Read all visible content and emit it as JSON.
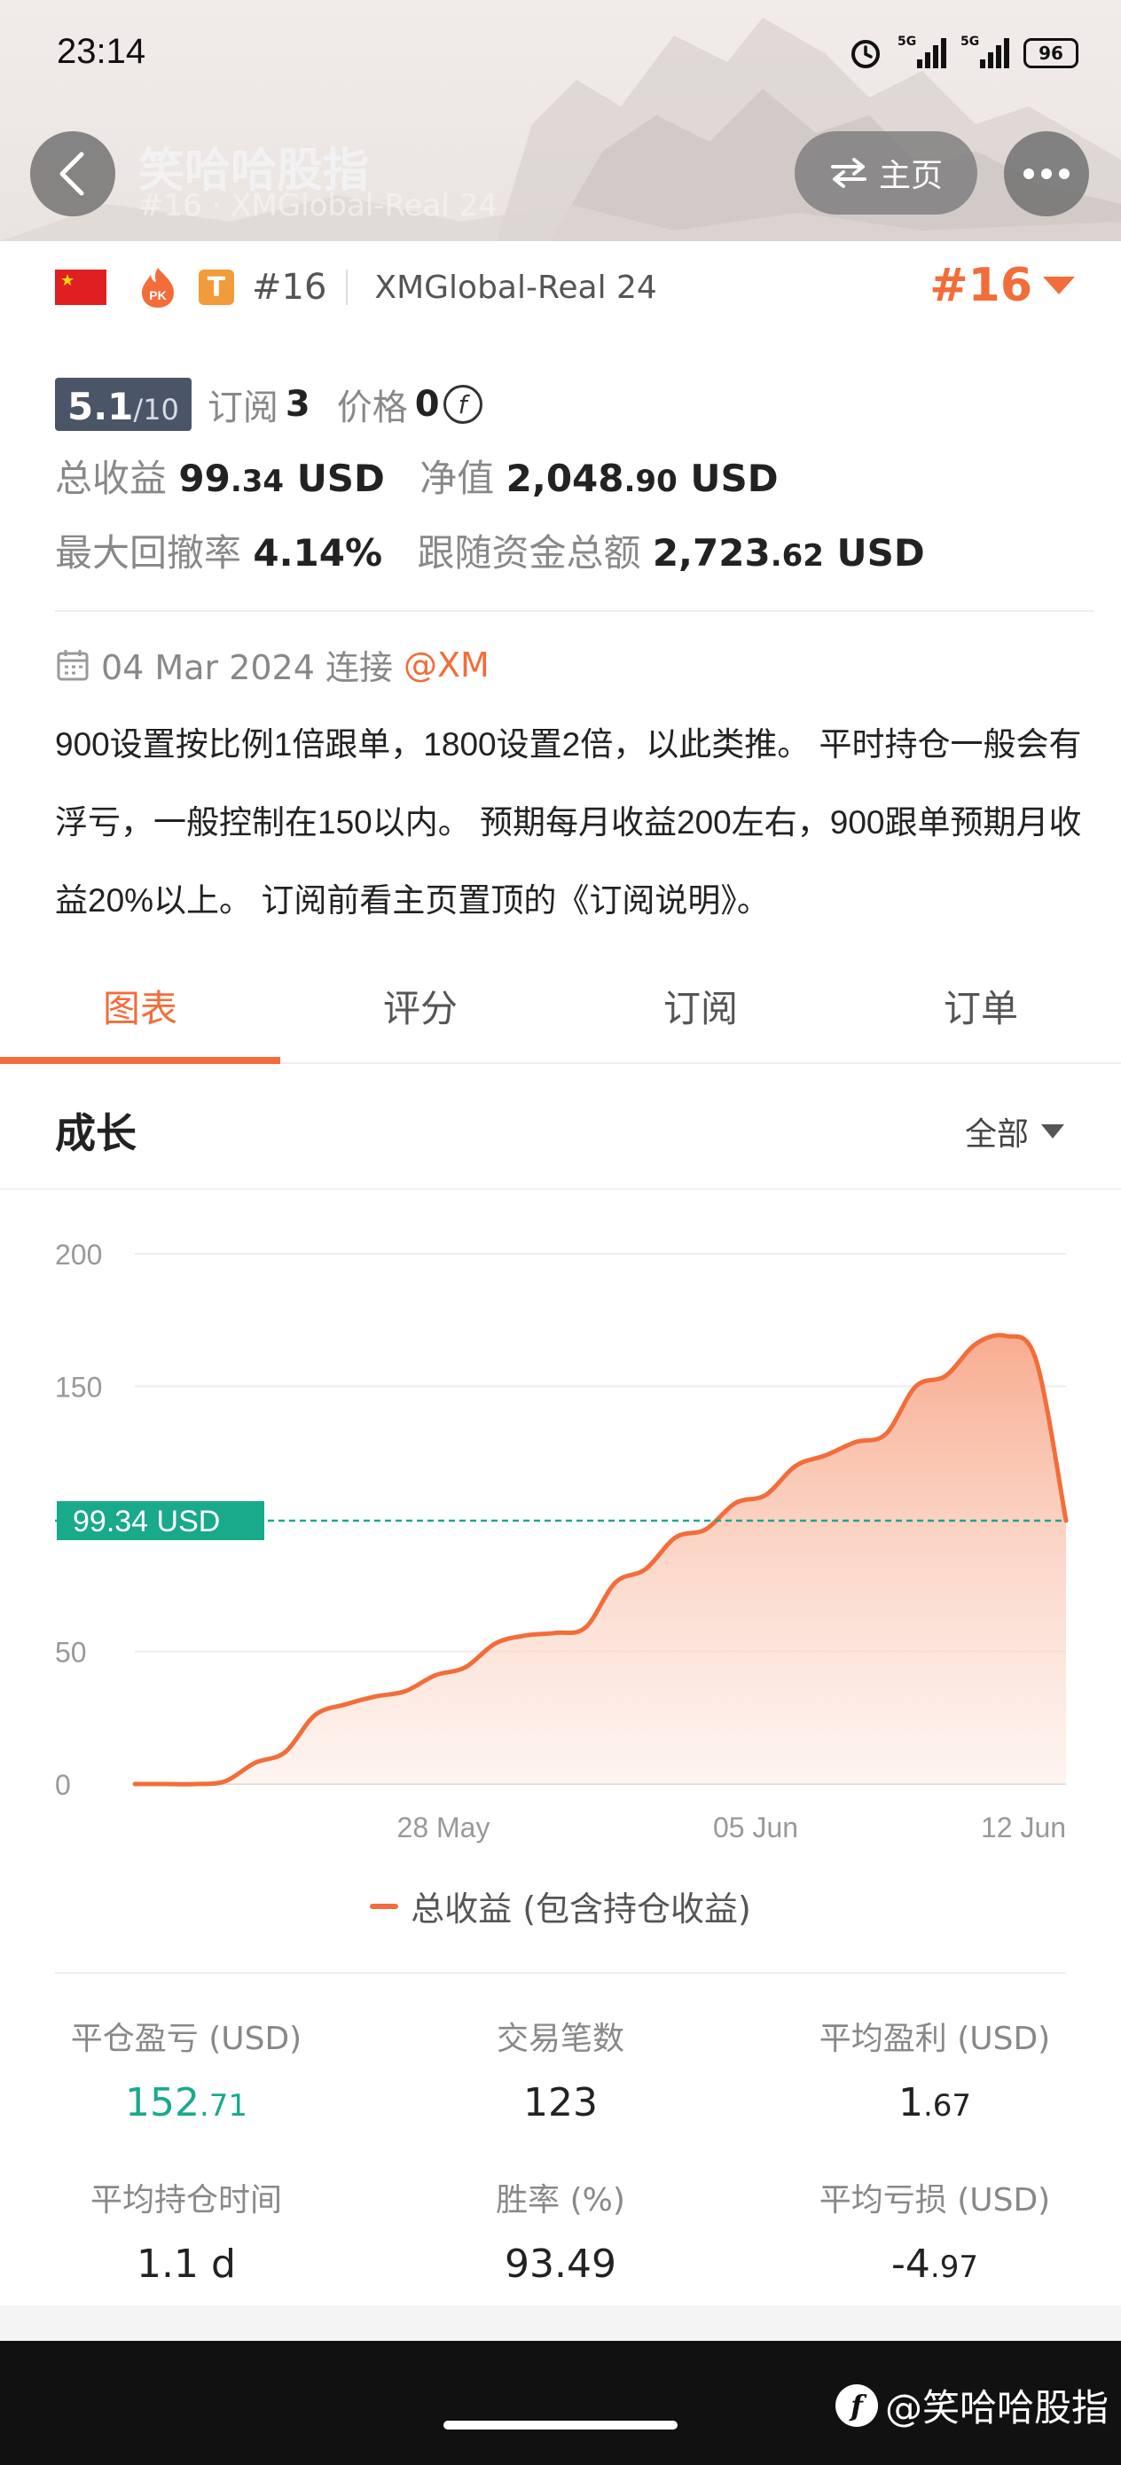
{
  "status_bar": {
    "time": "23:14",
    "signal1": "5G",
    "signal2": "5G",
    "battery": "96"
  },
  "nav": {
    "title": "笑哈哈股指",
    "subtitle": "#16 · XMGlobal-Real 24",
    "home_label": "主页"
  },
  "profile": {
    "rank_small": "#16",
    "server": "XMGlobal-Real 24",
    "rank_big": "#16",
    "score": "5.1",
    "score_max": "/10",
    "subscribe_label": "订阅",
    "subscribe_count": "3",
    "price_label": "价格",
    "price_value": "0",
    "total_profit_label": "总收益",
    "total_profit_int": "99",
    "total_profit_dec": ".34",
    "total_profit_unit": "USD",
    "equity_label": "净值",
    "equity_int": "2,048",
    "equity_dec": ".90",
    "equity_unit": "USD",
    "drawdown_label": "最大回撤率",
    "drawdown_value": "4.14%",
    "follow_funds_label": "跟随资金总额",
    "follow_funds_int": "2,723",
    "follow_funds_dec": ".62",
    "follow_funds_unit": "USD",
    "connect_text": "04 Mar 2024 连接",
    "broker": "@XM",
    "description": "900设置按比例1倍跟单，1800设置2倍，以此类推。 平时持仓一般会有浮亏，一般控制在150以内。 预期每月收益200左右，900跟单预期月收益20%以上。 订阅前看主页置顶的《订阅说明》。"
  },
  "tabs": [
    {
      "label": "图表",
      "active": true
    },
    {
      "label": "评分",
      "active": false
    },
    {
      "label": "订阅",
      "active": false
    },
    {
      "label": "订单",
      "active": false
    }
  ],
  "growth": {
    "title": "成长",
    "filter": "全部"
  },
  "chart_data": {
    "type": "area",
    "title": "",
    "xlabel": "",
    "ylabel": "",
    "ylim": [
      0,
      200
    ],
    "y_ticks": [
      "200",
      "150",
      "50",
      "0"
    ],
    "x_ticks": [
      "28 May",
      "05 Jun",
      "12 Jun"
    ],
    "current_label": "99.34 USD",
    "current_value": 99.34,
    "series": [
      {
        "name": "总收益 (包含持仓收益)",
        "values": [
          0,
          0,
          0,
          1,
          8,
          12,
          26,
          30,
          33,
          35,
          41,
          44,
          53,
          56,
          57,
          59,
          76,
          81,
          93,
          96,
          106,
          109,
          120,
          124,
          129,
          132,
          150,
          154,
          166,
          169,
          160,
          99.34
        ]
      }
    ],
    "legend": "bottom"
  },
  "stats": [
    {
      "label": "平仓盈亏 (USD)",
      "int": "152",
      "dec": ".71",
      "color": "#19a98b"
    },
    {
      "label": "交易笔数",
      "int": "123",
      "dec": ""
    },
    {
      "label": "平均盈利 (USD)",
      "int": "1",
      "dec": ".67"
    },
    {
      "label": "平均持仓时间",
      "int": "1.1 d",
      "dec": ""
    },
    {
      "label": "胜率 (%)",
      "int": "93.49",
      "dec": ""
    },
    {
      "label": "平均亏损 (USD)",
      "int": "-4",
      "dec": ".97"
    }
  ],
  "watermark": {
    "text": "@笑哈哈股指",
    "logo": "f"
  },
  "colors": {
    "accent": "#f26d3a",
    "green": "#19a98b",
    "score_bg": "#4a5568"
  }
}
